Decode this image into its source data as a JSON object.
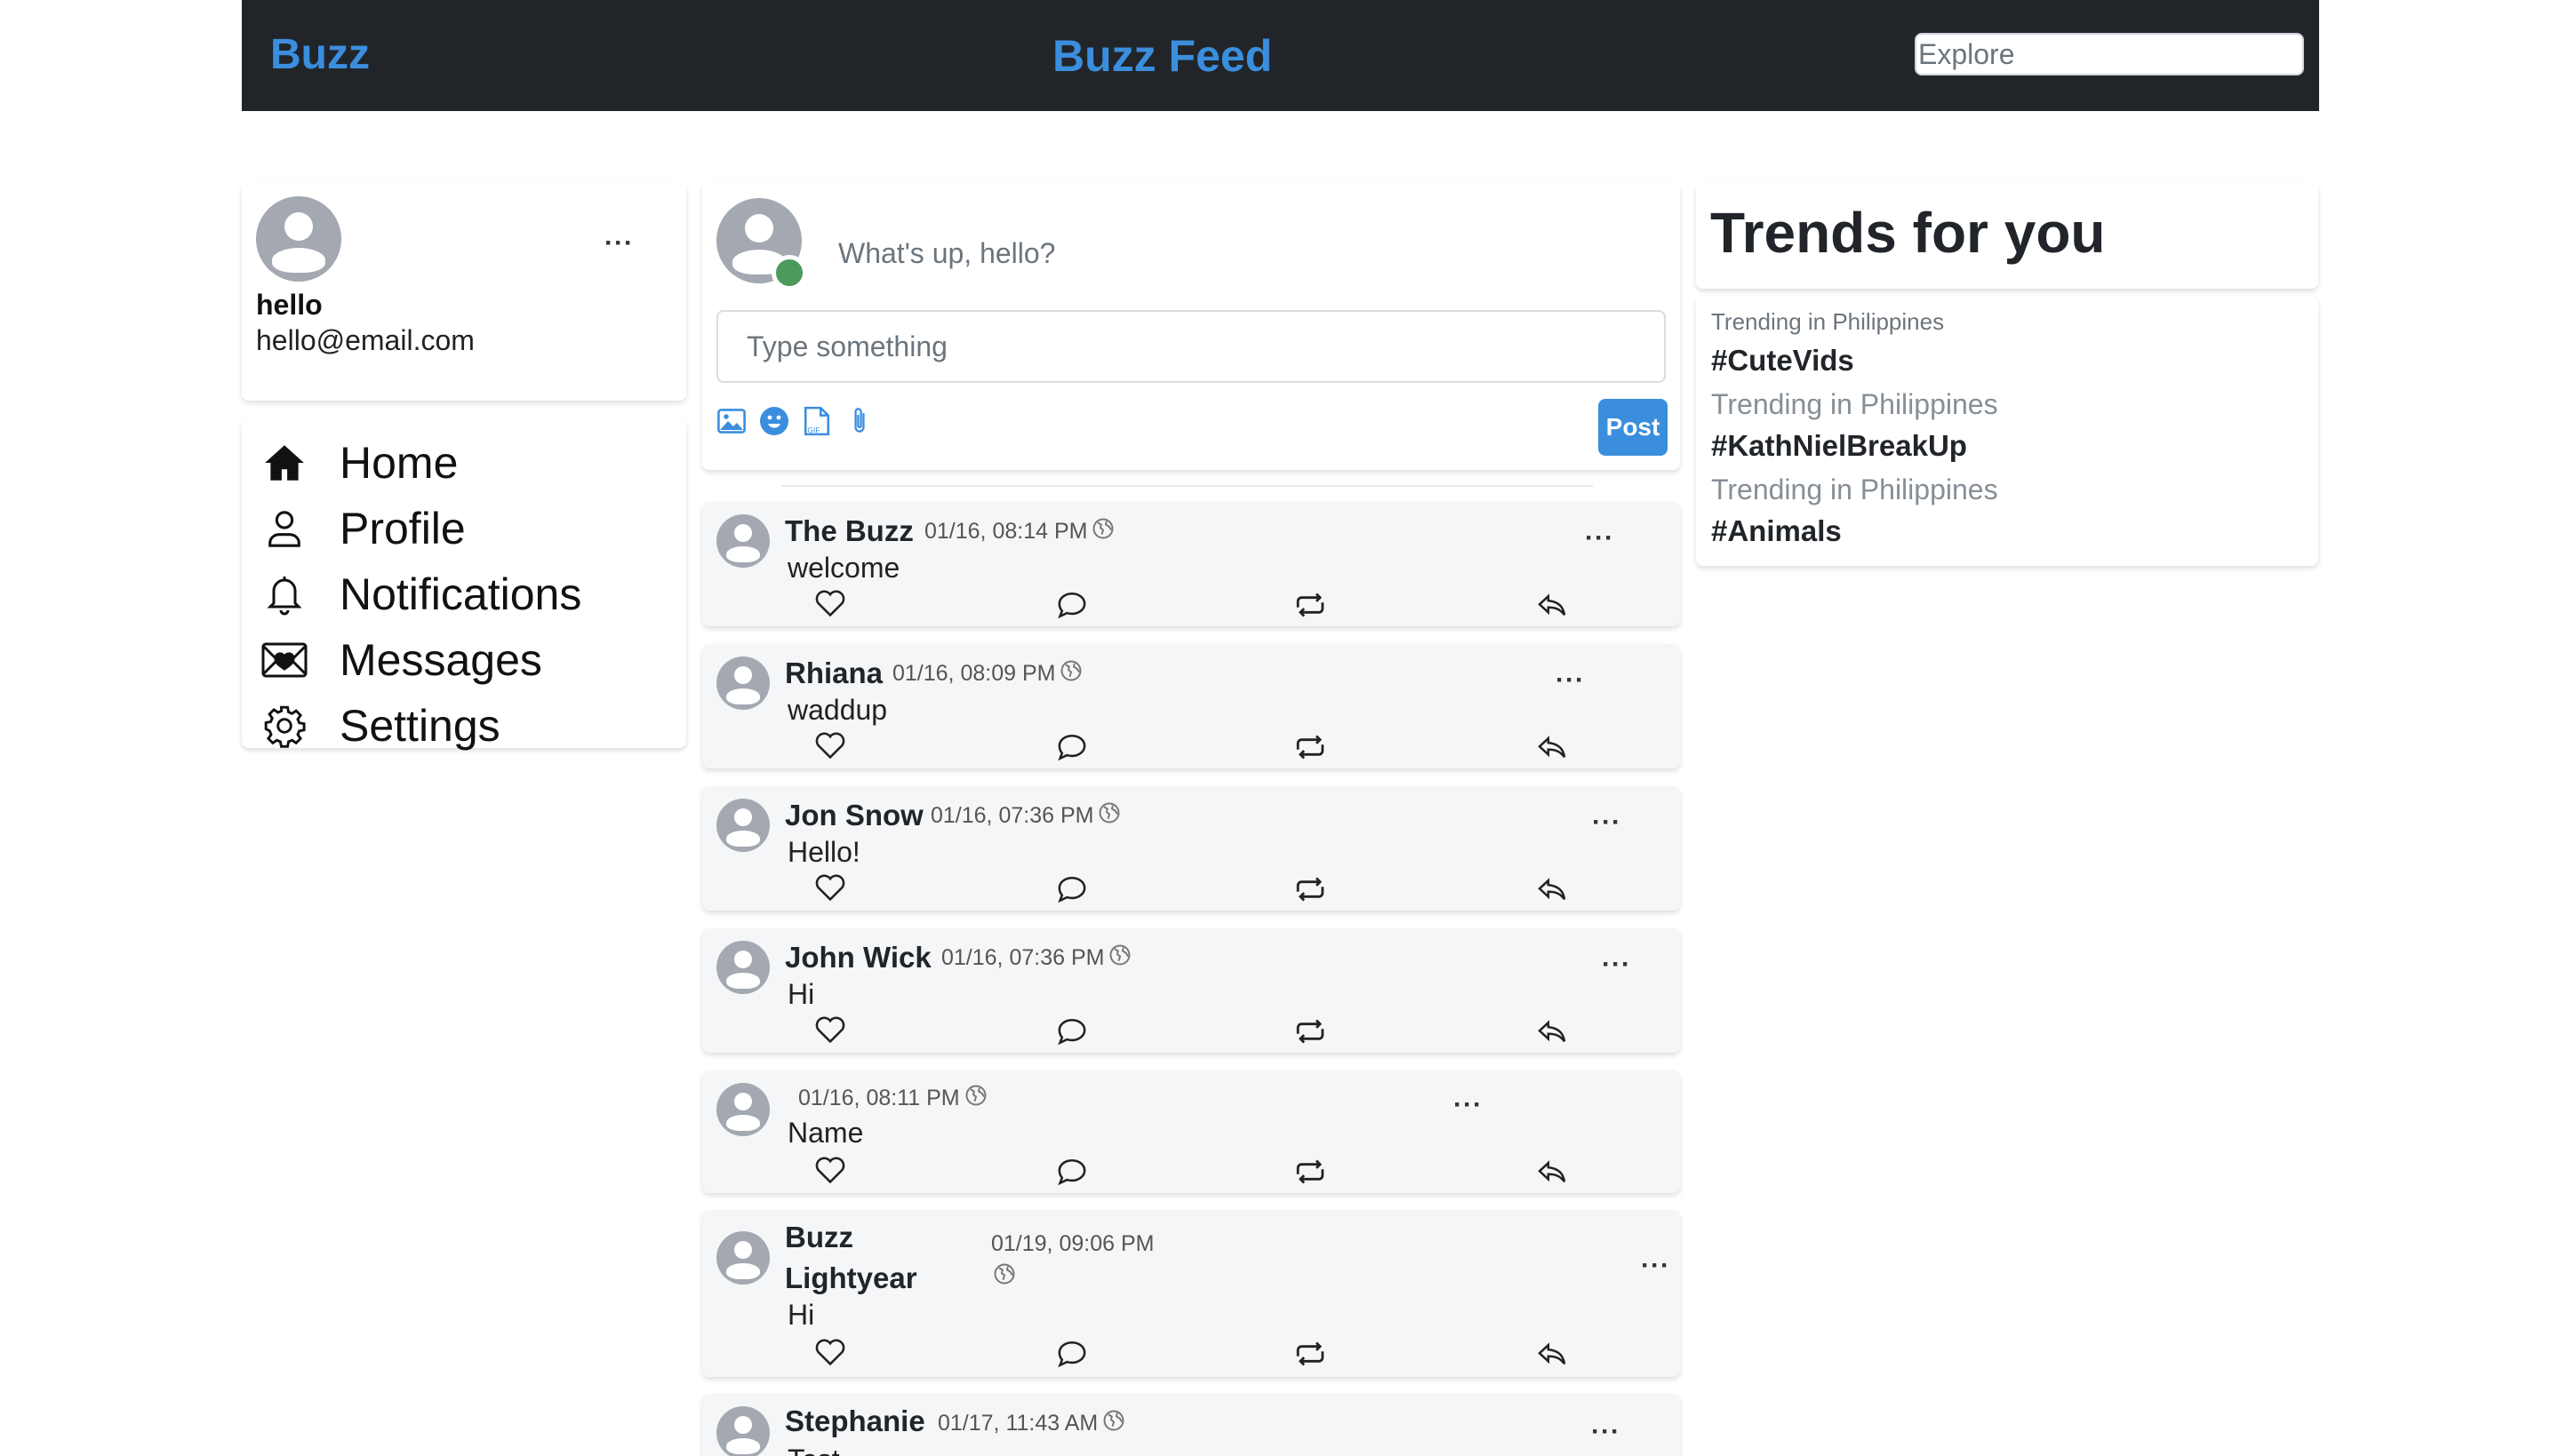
{
  "header": {
    "brand": "Buzz",
    "title": "Buzz Feed",
    "search_placeholder": "Explore"
  },
  "profile": {
    "name": "hello",
    "email": "hello@email.com",
    "menu_icon": "ellipsis-icon"
  },
  "nav": {
    "items": [
      {
        "label": "Home",
        "icon": "home-icon"
      },
      {
        "label": "Profile",
        "icon": "user-icon"
      },
      {
        "label": "Notifications",
        "icon": "bell-icon"
      },
      {
        "label": "Messages",
        "icon": "envelope-heart-icon"
      },
      {
        "label": "Settings",
        "icon": "gear-icon"
      }
    ]
  },
  "composer": {
    "prompt": "What's up, hello?",
    "input_placeholder": "Type something",
    "tools": [
      "image-icon",
      "emoji-icon",
      "gif-icon",
      "attachment-icon"
    ],
    "post_label": "Post",
    "status_color": "#4c9a5e"
  },
  "posts": [
    {
      "author": "The Buzz",
      "time": "01/16, 08:14 PM",
      "text": "welcome"
    },
    {
      "author": "Rhiana",
      "time": "01/16, 08:09 PM",
      "text": "waddup"
    },
    {
      "author": "Jon Snow",
      "time": "01/16, 07:36 PM",
      "text": "Hello!"
    },
    {
      "author": "John Wick",
      "time": "01/16, 07:36 PM",
      "text": "Hi"
    },
    {
      "author": "",
      "time": "01/16, 08:11 PM",
      "text": "Name"
    },
    {
      "author_line1": "Buzz",
      "author_line2": "Lightyear",
      "time": "01/19, 09:06 PM",
      "text": "Hi"
    },
    {
      "author": "Stephanie",
      "time": "01/17, 11:43 AM",
      "text": "Test"
    }
  ],
  "post_actions": [
    "heart-icon",
    "comment-icon",
    "retweet-icon",
    "reply-icon"
  ],
  "trends": {
    "title": "Trends for you",
    "items": [
      {
        "context": "Trending in Philippines",
        "tag": "#CuteVids"
      },
      {
        "context": "Trending in Philippines",
        "tag": "#KathNielBreakUp"
      },
      {
        "context": "Trending in Philippines",
        "tag": "#Animals"
      }
    ]
  },
  "colors": {
    "header_bg": "#212529",
    "accent": "#3b8ede",
    "post_bg": "#f5f6f7"
  }
}
